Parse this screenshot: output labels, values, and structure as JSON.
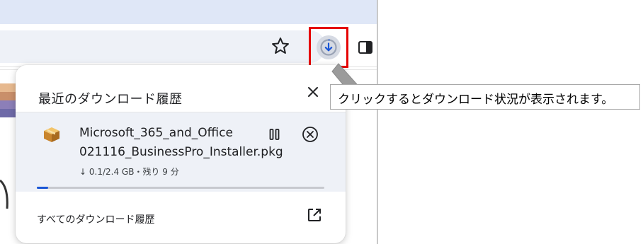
{
  "popup": {
    "title": "最近のダウンロード履歴",
    "close_icon": "close-icon",
    "item": {
      "icon": "package-icon",
      "filename_line1": "Microsoft_365_and_Office",
      "filename_line2": "021116_BusinessPro_Installer.pkg",
      "progress_text": "↓ 0.1/2.4 GB・残り 9 分",
      "progress_fraction": 0.04,
      "pause_icon": "pause-icon",
      "cancel_icon": "cancel-icon"
    },
    "all_history_label": "すべてのダウンロード履歴",
    "open_external_icon": "open-external-icon"
  },
  "toolbar": {
    "star_icon": "star-icon",
    "download_icon": "download-icon",
    "side_panel_icon": "side-panel-icon"
  },
  "callout": {
    "text": "クリックするとダウンロード状況が表示されます。"
  },
  "colors": {
    "highlight": "#e50000",
    "progress": "#1a56d6",
    "download_button_bg": "#d6dae3",
    "address_bar_bg": "#eef1f7",
    "item_bg": "#eef1f7"
  }
}
